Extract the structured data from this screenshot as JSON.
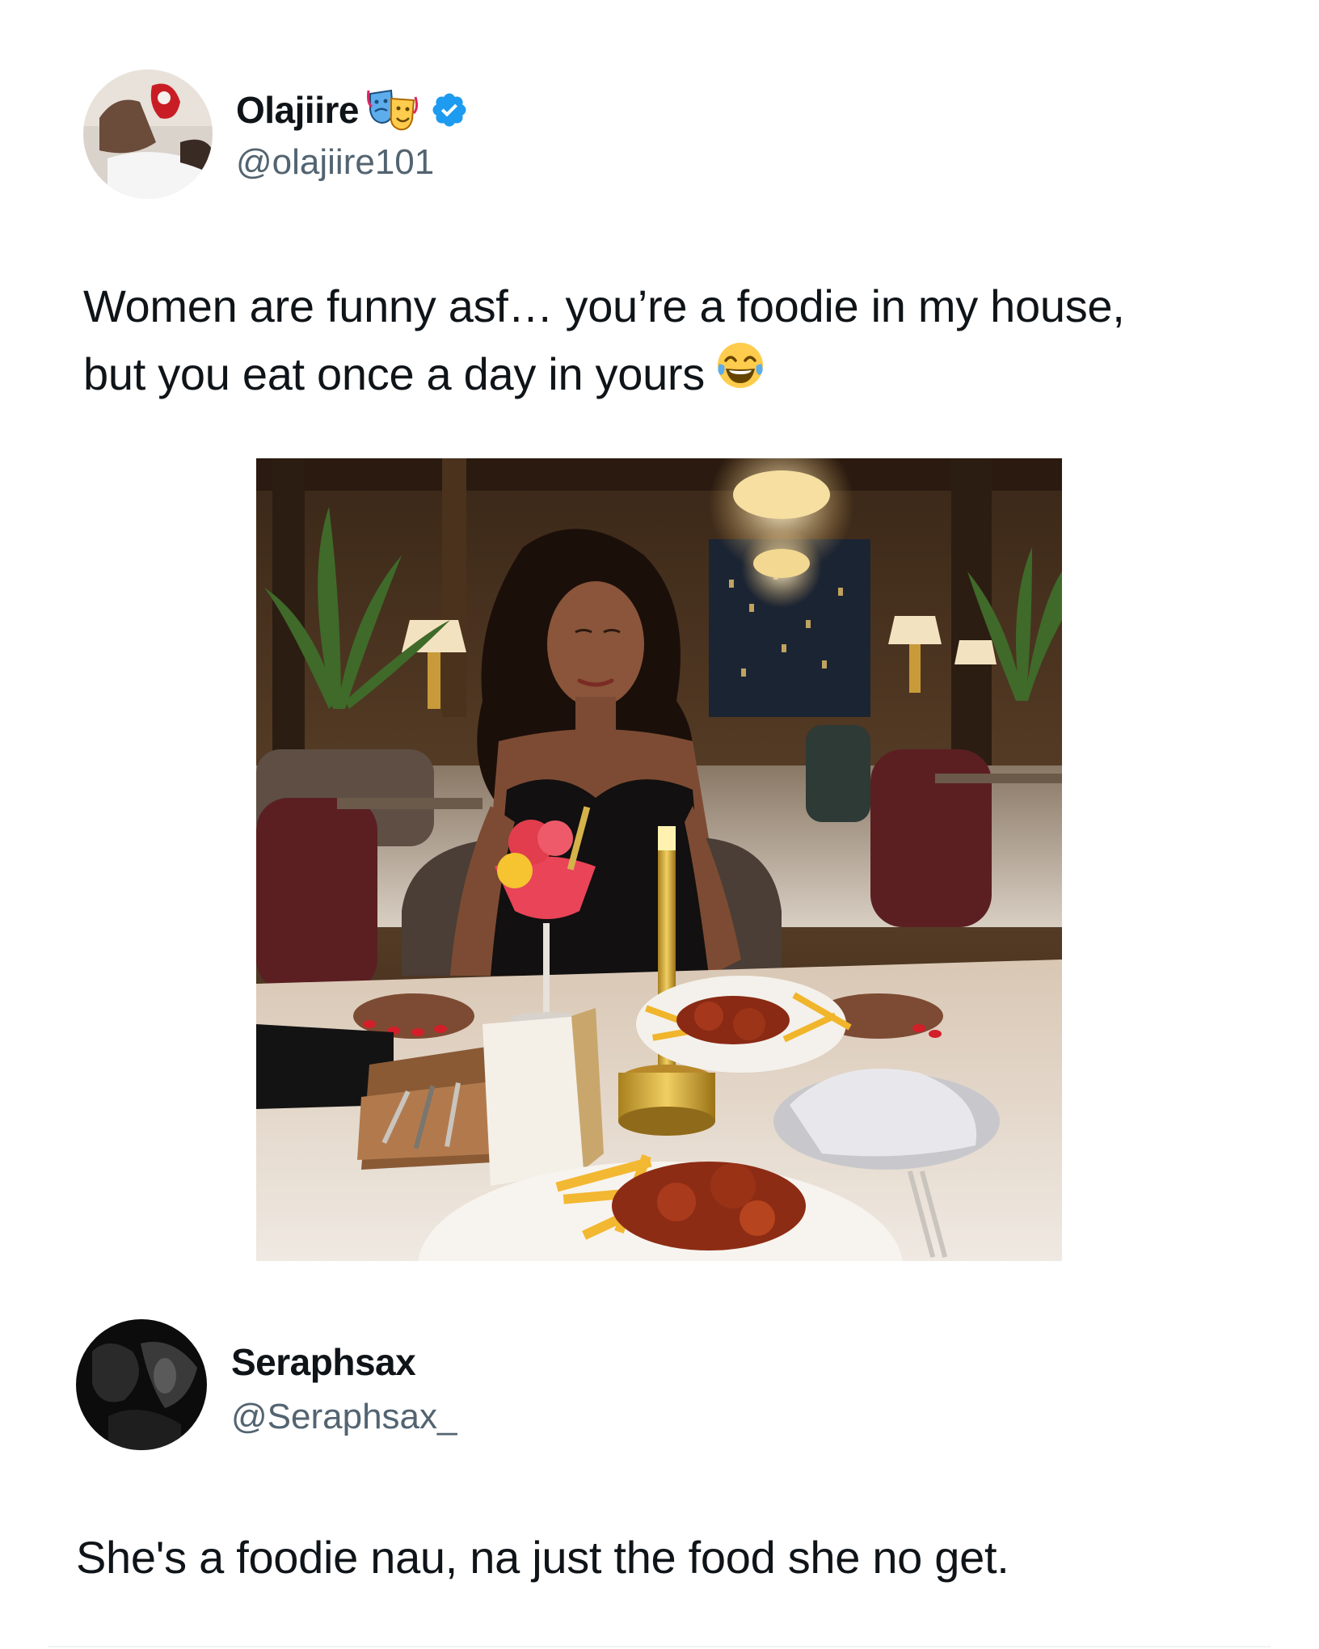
{
  "tweets": [
    {
      "display_name": "Olajiire",
      "handle": "@olajiire101",
      "name_emoji_icon": "performing-arts-icon",
      "verified_icon": "verified-badge-icon",
      "verified_color": "#1d9bf0",
      "text_line1": "Women are funny asf… you’re a foodie in my house,",
      "text_line2": "but you eat once a day in yours",
      "text_emoji_icon": "face-with-tears-of-joy-icon",
      "media_icon": "restaurant-photo-image"
    },
    {
      "display_name": "Seraphsax",
      "handle": "@Seraphsax_",
      "text": "She's a foodie nau, na just the food she no get."
    }
  ],
  "colors": {
    "text_primary": "#0f1419",
    "text_secondary": "#536471",
    "background": "#ffffff"
  }
}
